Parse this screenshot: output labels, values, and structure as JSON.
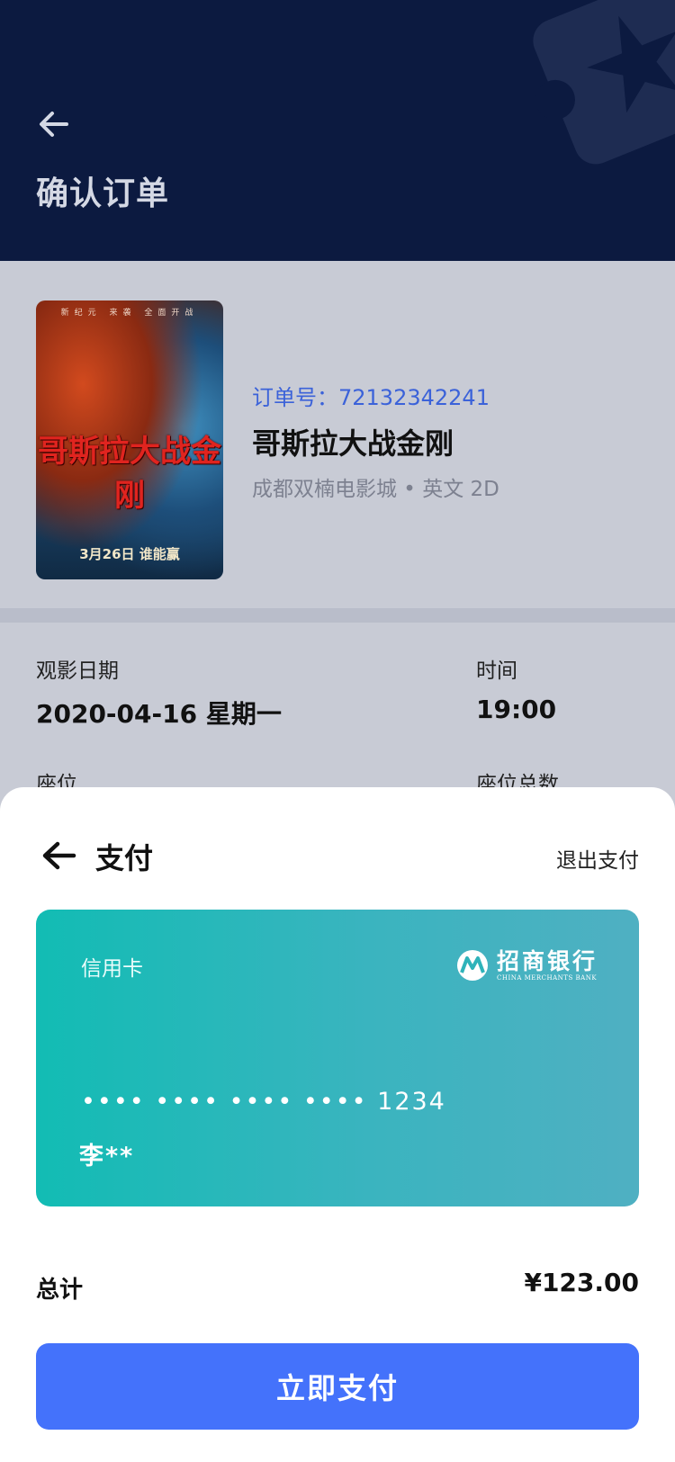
{
  "header": {
    "title": "确认订单",
    "back_icon": "arrow-left-icon"
  },
  "movie": {
    "order_number": "订单号：72132342241",
    "name": "哥斯拉大战金刚",
    "cinema_info": "成都双楠电影城 • 英文 2D",
    "poster": {
      "top_text": "新纪元 来袭 全面开战",
      "title": "哥斯拉大战金刚",
      "date_text": "3月26日 谁能赢"
    }
  },
  "info": {
    "date_label": "观影日期",
    "date_value": "2020-04-16 星期一",
    "time_label": "时间",
    "time_value": "19:00",
    "seat_label": "座位",
    "seat_total_label": "座位总数"
  },
  "payment": {
    "title": "支付",
    "back_icon": "arrow-left-icon",
    "exit_label": "退出支付",
    "card": {
      "type": "信用卡",
      "bank_name_cn": "招商银行",
      "bank_name_en": "CHINA MERCHANTS BANK",
      "bank_logo_icon": "cmb-logo-icon",
      "number": "•••• •••• •••• •••• 1234",
      "holder": "李**"
    },
    "total_label": "总计",
    "total_value": "¥123.00",
    "pay_button": "立即支付"
  },
  "colors": {
    "header_bg": "#0c1a40",
    "page_bg": "#c8cbd5",
    "accent": "#4472fb",
    "order_no": "#3b62d9",
    "card_start": "#12bcb4",
    "card_end": "#4fb0c2"
  }
}
